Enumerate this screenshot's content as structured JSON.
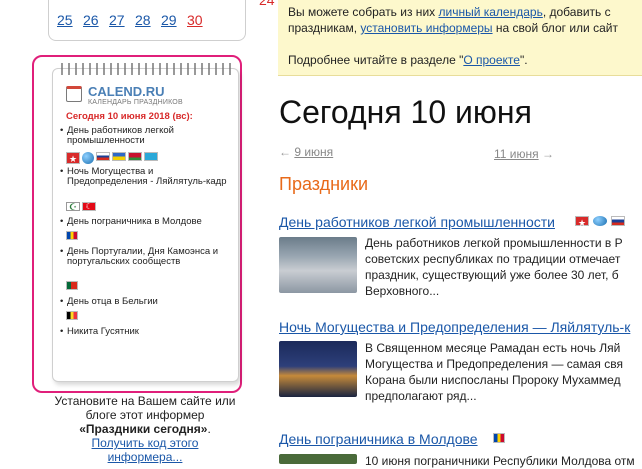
{
  "mini_calendar": {
    "days": [
      "25",
      "26",
      "27",
      "28",
      "29",
      "30"
    ],
    "weekend_days": [
      "30"
    ],
    "partial_top_value": "24"
  },
  "widget": {
    "logo_text": "CALEND.RU",
    "logo_sub": "КАЛЕНДАРЬ ПРАЗДНИКОВ",
    "date_header": "Сегодня 10 июня 2018 (вс):",
    "items": [
      {
        "label": "День работников легкой промышленности",
        "flags": [
          "ru-red-star",
          "globe",
          "ru",
          "ua",
          "by",
          "kz"
        ]
      },
      {
        "label": "Ночь Могущества и Предопределения - Ляйлятуль-кадр",
        "flags": [
          "islam",
          "tr"
        ]
      },
      {
        "label": "День пограничника в Молдове",
        "flags": [
          "md"
        ]
      },
      {
        "label": "День Португалии, Дня Камоэнса и португальских сообществ",
        "flags": [
          "pt"
        ]
      },
      {
        "label": "День отца в Бельгии",
        "flags": [
          "be"
        ]
      },
      {
        "label": "Никита Гусятник",
        "flags": []
      }
    ]
  },
  "install": {
    "line1": "Установите на Вашем сайте или",
    "line2": "блоге этот информер",
    "bold": "«Праздники сегодня»",
    "get_code": "Получить код этого",
    "get_code_2": "информера..."
  },
  "notice": {
    "line1_prefix": "Вы можете собрать из них",
    "line1_link": "личный календарь",
    "line1_suffix": ", добавить с",
    "line2_prefix": "праздникам,",
    "line2_link": "установить информеры",
    "line2_suffix": "на свой блог или сайт",
    "line3_prefix": "Подробнее читайте в разделе \"",
    "line3_link": "О проекте",
    "line3_suffix": "\"."
  },
  "page_title": "Сегодня 10 июня",
  "nav": {
    "prev_arrow": "←",
    "prev": "9 июня",
    "next": "11 июня",
    "next_arrow": "→"
  },
  "section_title": "Праздники",
  "holidays": [
    {
      "title": "День работников легкой промышленности",
      "desc": [
        "День работников легкой промышленности в Р",
        "советских республиках по традиции отмечает",
        "праздник, существующий уже более 30 лет, б",
        "Верховного..."
      ]
    },
    {
      "title": "Ночь Могущества и Предопределения — Ляйлятуль-к",
      "desc": [
        "В Священном месяце Рамадан есть ночь Ляй",
        "Могущества и Предопределения — самая свя",
        "Корана были ниспосланы Пророку Мухаммед",
        "предполагают ряд..."
      ]
    },
    {
      "title": "День пограничника в Молдове",
      "desc": [
        "10 июня пограничники Республики Молдова отм"
      ]
    }
  ],
  "colors": {
    "link": "#1a57a8",
    "accent_red": "#d82a2a",
    "section_orange": "#e86a1a",
    "highlight_pink": "#e01f7a",
    "notice_bg": "#fdf8cc"
  }
}
